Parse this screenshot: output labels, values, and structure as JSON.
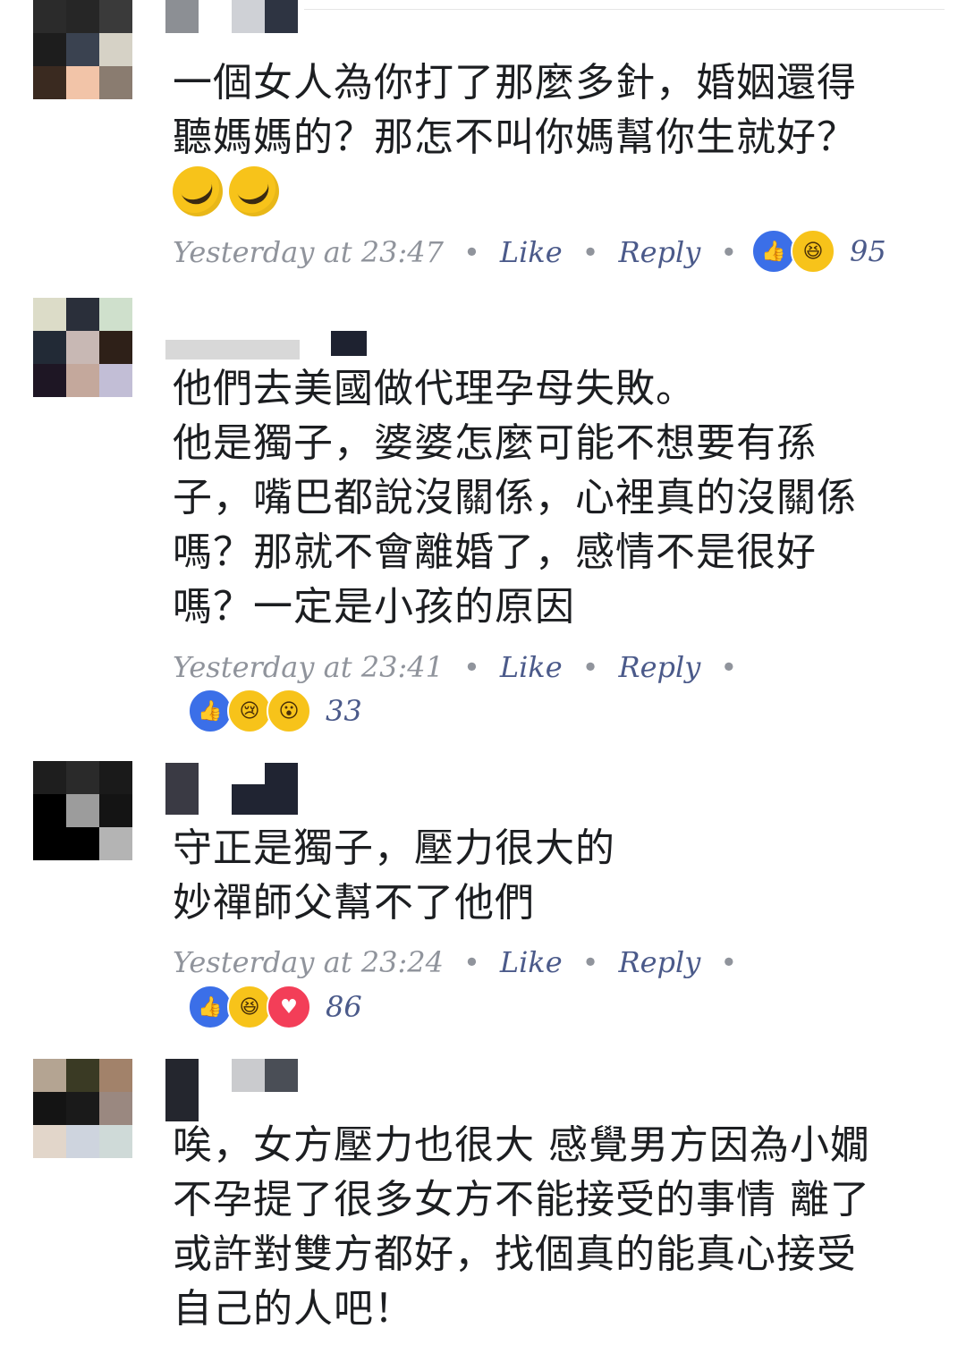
{
  "comments": [
    {
      "text": "一個女人為你打了那麼多針，婚姻還得\n聽媽媽的？那怎不叫你媽幫你生就好？",
      "emojis": [
        "rolling-on-floor-laughing",
        "rolling-on-floor-laughing"
      ],
      "timestamp": "Yesterday at 23:47",
      "like_label": "Like",
      "reply_label": "Reply",
      "separator": "•",
      "reactions": [
        "like",
        "haha"
      ],
      "reaction_count": "95"
    },
    {
      "text": "他們去美國做代理孕母失敗。\n他是獨子，婆婆怎麼可能不想要有孫\n子，嘴巴都說沒關係，心裡真的沒關係\n嗎？那就不會離婚了，感情不是很好\n嗎？一定是小孩的原因",
      "timestamp": "Yesterday at 23:41",
      "like_label": "Like",
      "reply_label": "Reply",
      "separator": "•",
      "reactions": [
        "like",
        "sad",
        "wow"
      ],
      "reaction_count": "33"
    },
    {
      "text": "守正是獨子，壓力很大的\n妙禪師父幫不了他們",
      "timestamp": "Yesterday at 23:24",
      "like_label": "Like",
      "reply_label": "Reply",
      "separator": "•",
      "reactions": [
        "like",
        "haha",
        "love"
      ],
      "reaction_count": "86"
    },
    {
      "text": "唉，女方壓力也很大 感覺男方因為小嫺\n不孕提了很多女方不能接受的事情 離了\n或許對雙方都好，找個真的能真心接受\n自己的人吧！"
    }
  ],
  "colors": {
    "text": "#1c1e21",
    "meta": "#90949c",
    "action": "#4b5a8a",
    "like_blue": "#3b6fe8",
    "love_red": "#f33e58",
    "emoji_yellow": "#f7c31a"
  }
}
